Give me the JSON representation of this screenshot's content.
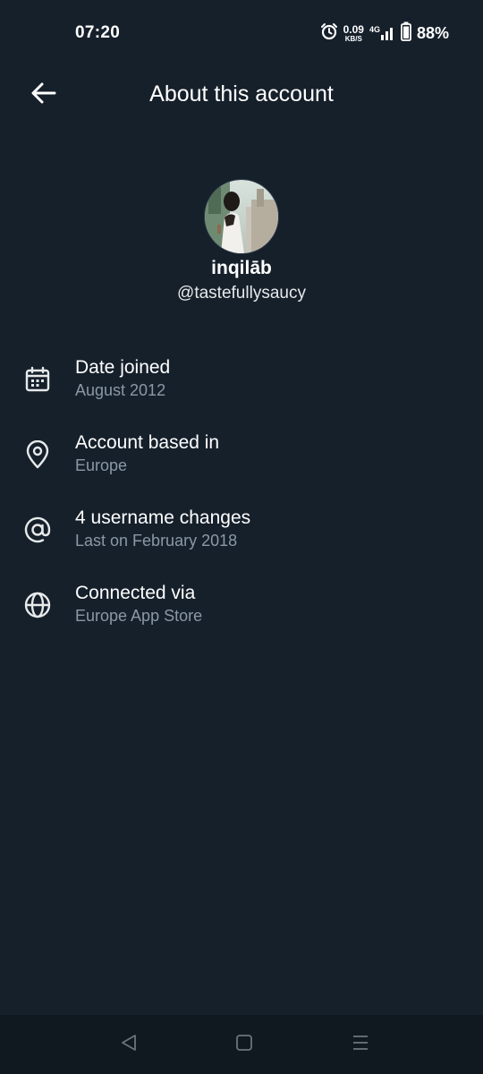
{
  "status_bar": {
    "time": "07:20",
    "net_speed_value": "0.09",
    "net_speed_unit": "KB/S",
    "network_type": "4G",
    "battery_percent": "88%"
  },
  "header": {
    "title": "About this account",
    "back_icon": "arrow-left-icon"
  },
  "profile": {
    "display_name": "inqilāb",
    "handle": "@tastefullysaucy"
  },
  "info_items": [
    {
      "icon": "calendar-icon",
      "title": "Date joined",
      "subtitle": "August 2012"
    },
    {
      "icon": "location-pin-icon",
      "title": "Account based in",
      "subtitle": "Europe"
    },
    {
      "icon": "at-sign-icon",
      "title": "4 username changes",
      "subtitle": "Last on February 2018"
    },
    {
      "icon": "globe-icon",
      "title": "Connected via",
      "subtitle": "Europe App Store"
    }
  ],
  "nav_bar": {
    "back": "triangle-back-icon",
    "home": "square-home-icon",
    "menu": "hamburger-menu-icon"
  },
  "colors": {
    "background": "#16202b",
    "secondary_text": "#8b98a5",
    "nav_background": "#101820"
  }
}
